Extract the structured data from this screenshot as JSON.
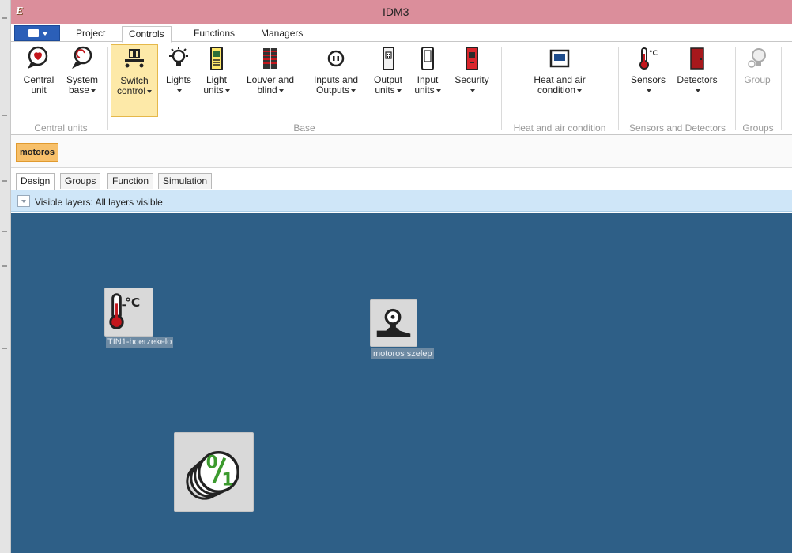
{
  "window": {
    "title": "IDM3"
  },
  "ribbon_tabs": [
    {
      "label": "Project",
      "active": false
    },
    {
      "label": "Controls",
      "active": true
    },
    {
      "label": "Functions",
      "active": false
    },
    {
      "label": "Managers",
      "active": false
    }
  ],
  "ribbon": {
    "buttons": {
      "central_unit": "Central unit",
      "system_base": "System base",
      "switch_control": "Switch control",
      "lights": "Lights",
      "light_units": "Light units",
      "louver_and_blind": "Louver and blind",
      "inputs_and_outputs": "Inputs and Outputs",
      "output_units": "Output units",
      "input_units": "Input units",
      "security": "Security",
      "heat_and_air_condition": "Heat and air condition",
      "sensors": "Sensors",
      "detectors": "Detectors",
      "group": "Group"
    },
    "groups": {
      "central_units": "Central units",
      "base": "Base",
      "heat_and_air_condition": "Heat and air condition",
      "sensors_and_detectors": "Sensors and Detectors",
      "groups": "Groups"
    }
  },
  "document_tab": "motoros",
  "view_tabs": [
    {
      "label": "Design",
      "active": true
    },
    {
      "label": "Groups",
      "active": false
    },
    {
      "label": "Function",
      "active": false
    },
    {
      "label": "Simulation",
      "active": false
    }
  ],
  "layers": {
    "text": "Visible layers: All layers visible"
  },
  "canvas": {
    "nodes": {
      "tin1": "TIN1-hoerzekelo",
      "valve": "motoros szelep"
    }
  },
  "colors": {
    "title_bar": "#db8e9b",
    "canvas": "#2e5f87",
    "selected_button": "#fde9a8",
    "document_tab": "#f7c06a",
    "layers_bar": "#cfe6f8"
  }
}
